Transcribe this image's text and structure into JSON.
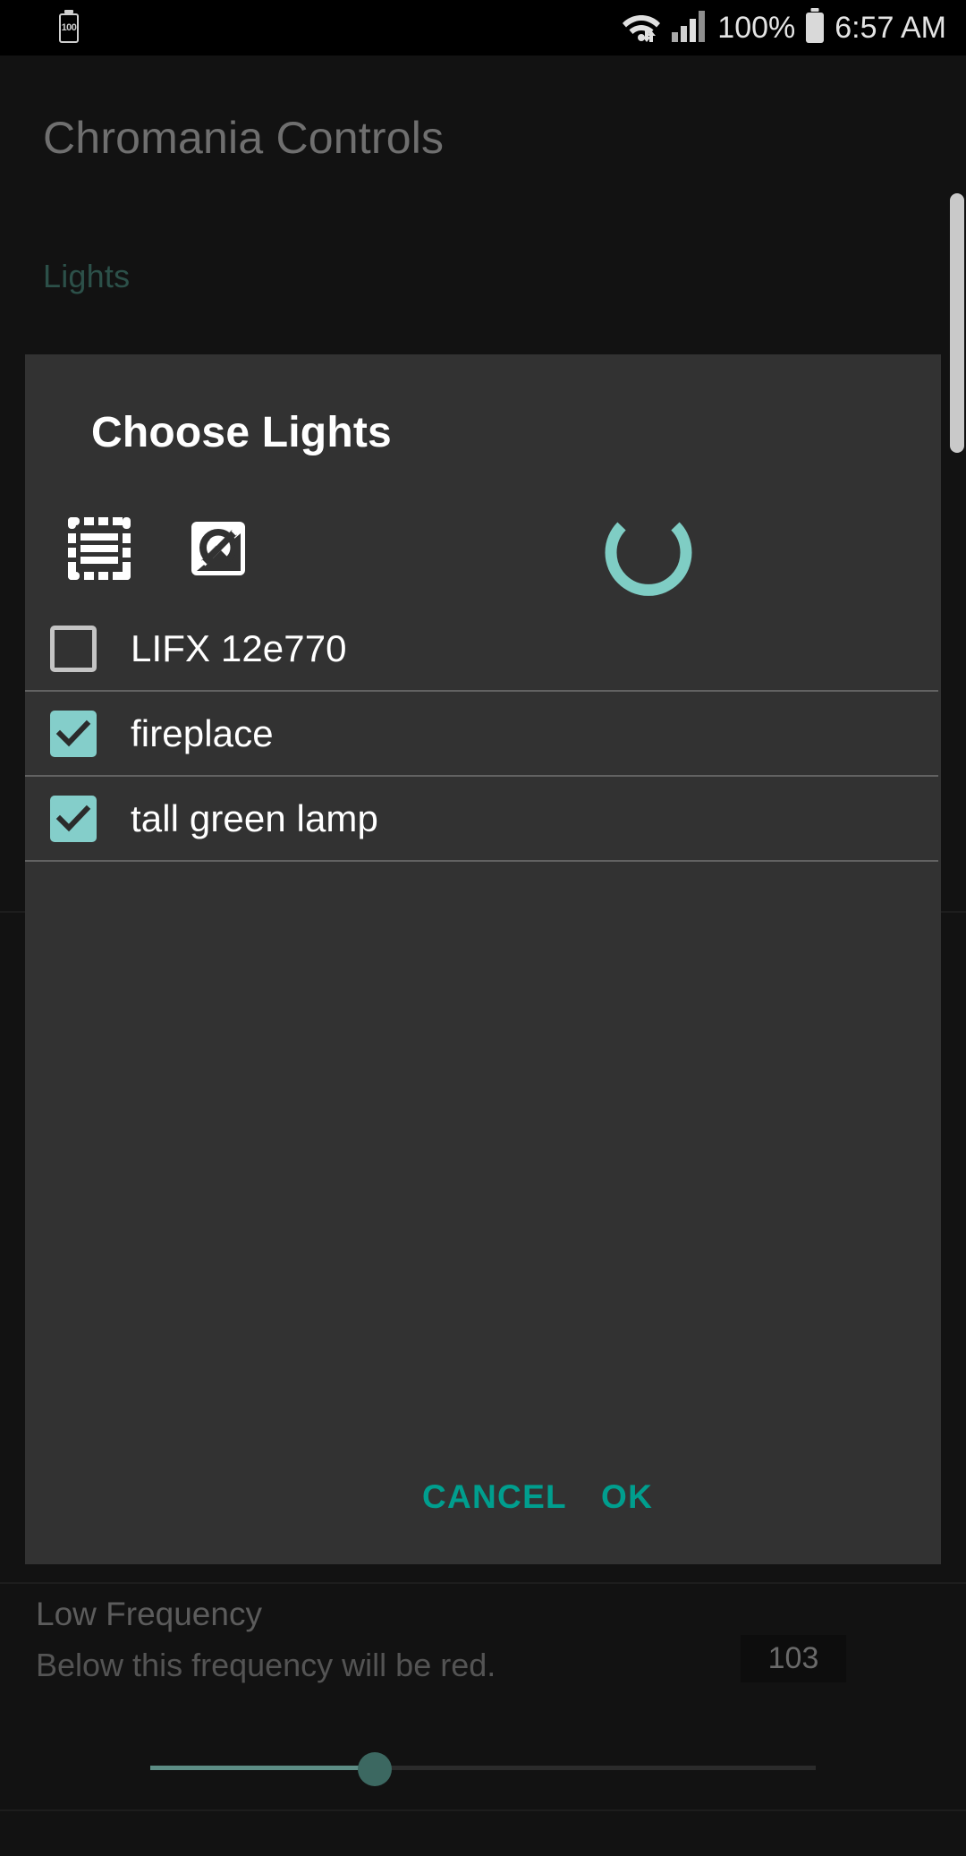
{
  "status_bar": {
    "battery_notification_label": "100",
    "wifi_icon": "wifi-icon",
    "signal_icon": "cell-signal-icon",
    "battery_percent": "100%",
    "battery_icon": "battery-full-icon",
    "time": "6:57 AM"
  },
  "app": {
    "title": "Chromania Controls",
    "section_lights_label": "Lights"
  },
  "dialog": {
    "title": "Choose Lights",
    "toolbar": {
      "select_all_icon": "select-all-icon",
      "select_none_icon": "select-none-icon",
      "spinner_icon": "loading-spinner-icon"
    },
    "lights": [
      {
        "label": "LIFX 12e770",
        "checked": false
      },
      {
        "label": "fireplace",
        "checked": true
      },
      {
        "label": "tall green lamp",
        "checked": true
      }
    ],
    "cancel_label": "CANCEL",
    "ok_label": "OK"
  },
  "settings": {
    "low_frequency": {
      "title": "Low Frequency",
      "subtitle": "Below this frequency will be red.",
      "value": "103",
      "slider_percent": 34
    }
  },
  "colors": {
    "accent_teal": "#009e8e",
    "checkbox_teal": "#84ceca",
    "spinner_teal": "#7fcdc4",
    "dialog_bg": "#323232",
    "screen_bg": "#121212"
  }
}
